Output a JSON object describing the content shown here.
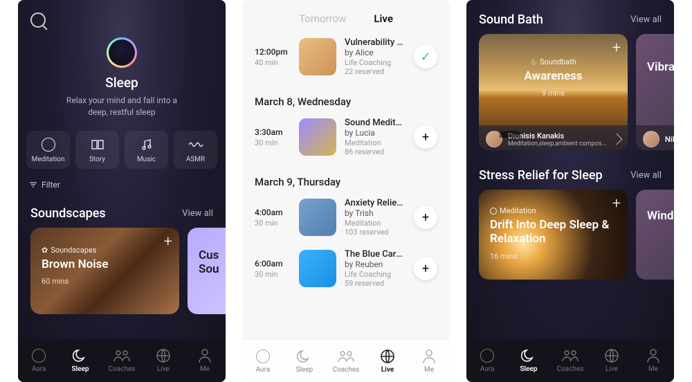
{
  "tabs": {
    "aura": "Aura",
    "sleep": "Sleep",
    "coaches": "Coaches",
    "live": "Live",
    "me": "Me"
  },
  "s1": {
    "title": "Sleep",
    "subtitle": "Relax your mind and fall into a deep, restful sleep",
    "cats": {
      "meditation": "Meditation",
      "story": "Story",
      "music": "Music",
      "asmr": "ASMR"
    },
    "filter": "Filter",
    "section": {
      "title": "Soundscapes",
      "viewall": "View all"
    },
    "card1": {
      "tag": "Soundscapes",
      "title": "Brown Noise",
      "dur": "60 mins"
    },
    "card2": {
      "title": "Cus\nSou"
    }
  },
  "s2": {
    "tabs": {
      "tomorrow": "Tomorrow",
      "live": "Live"
    },
    "rows": [
      {
        "date": "",
        "time": "12:00pm",
        "dur": "40 min",
        "title": "Vulnerability as Str...",
        "by": "by Alice",
        "cat": "Life Coaching",
        "res": "22 reserved",
        "checked": true,
        "thumb": "linear-gradient(135deg,#e8c080,#d0905a)"
      },
      {
        "date": "March 8, Wednesday",
        "time": "3:30am",
        "dur": "30 min",
        "title": "Sound Meditation ...",
        "by": "by Lucia",
        "cat": "Meditation",
        "res": "86 reserved",
        "checked": false,
        "thumb": "linear-gradient(135deg,#9a8cff,#d4b450)"
      },
      {
        "date": "March 9, Thursday",
        "time": "4:00am",
        "dur": "30 min",
        "title": "Anxiety Relief Now",
        "by": "by Trish",
        "cat": "Meditation",
        "res": "103 reserved",
        "checked": false,
        "thumb": "linear-gradient(135deg,#78a0d0,#5080b0)"
      },
      {
        "date": "",
        "time": "6:00am",
        "dur": "30 min",
        "title": "The Blue Cards",
        "by": "by Reuben",
        "cat": "Life Coaching",
        "res": "59 reserved",
        "checked": false,
        "thumb": "linear-gradient(135deg,#3ab0ff,#1a90e0)"
      }
    ]
  },
  "s3": {
    "sec1": {
      "title": "Sound Bath",
      "viewall": "View all"
    },
    "card1": {
      "tag": "Soundbath",
      "title": "Awareness",
      "dur": "9 mins",
      "coach": "Dionisis Kanakis",
      "coachsub": "Meditation,sleep,ambient compos..."
    },
    "card1b": {
      "title": "Vibrat",
      "coach": "Nila"
    },
    "sec2": {
      "title": "Stress Relief for Sleep",
      "viewall": "View all"
    },
    "card2": {
      "tag": "Meditation",
      "title": "Drift Into Deep Sleep & Relaxation",
      "dur": "16 mins"
    },
    "card2b": {
      "title": "Windin"
    }
  }
}
